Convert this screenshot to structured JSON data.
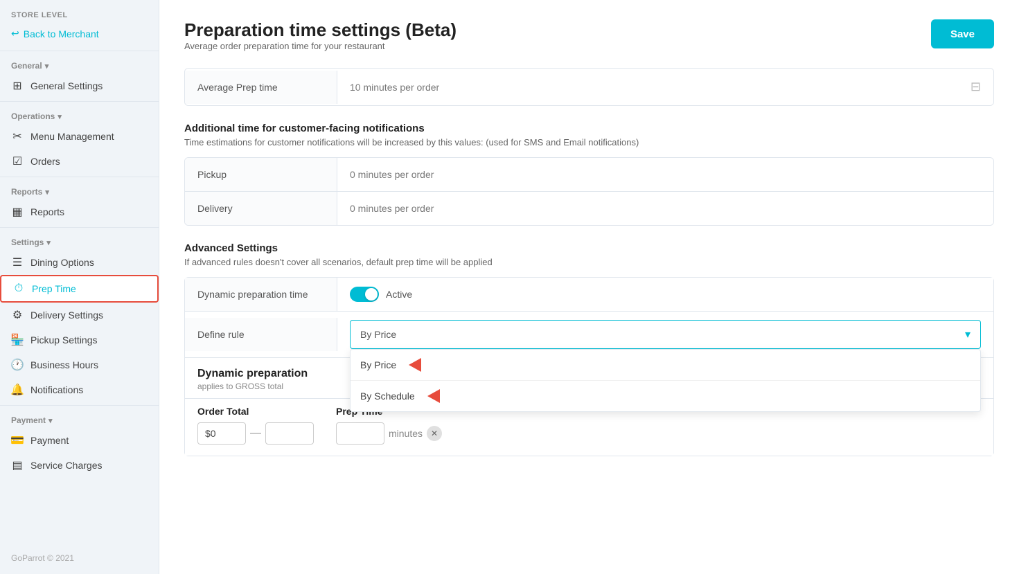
{
  "sidebar": {
    "store_level_label": "Store Level",
    "back_label": "Back to Merchant",
    "sections": [
      {
        "label": "General",
        "items": [
          {
            "id": "general-settings",
            "label": "General Settings",
            "icon": "grid"
          }
        ]
      },
      {
        "label": "Operations",
        "items": [
          {
            "id": "menu-management",
            "label": "Menu Management",
            "icon": "scissors"
          },
          {
            "id": "orders",
            "label": "Orders",
            "icon": "checkbox"
          }
        ]
      },
      {
        "label": "Reports",
        "items": [
          {
            "id": "reports",
            "label": "Reports",
            "icon": "chart"
          }
        ]
      },
      {
        "label": "Settings",
        "items": [
          {
            "id": "dining-options",
            "label": "Dining Options",
            "icon": "list"
          },
          {
            "id": "prep-time",
            "label": "Prep Time",
            "icon": "clock",
            "active": true
          },
          {
            "id": "delivery-settings",
            "label": "Delivery Settings",
            "icon": "delivery"
          },
          {
            "id": "pickup-settings",
            "label": "Pickup Settings",
            "icon": "pickup"
          },
          {
            "id": "business-hours",
            "label": "Business Hours",
            "icon": "hours"
          },
          {
            "id": "notifications",
            "label": "Notifications",
            "icon": "bell"
          }
        ]
      },
      {
        "label": "Payment",
        "items": [
          {
            "id": "payment",
            "label": "Payment",
            "icon": "payment"
          },
          {
            "id": "service-charges",
            "label": "Service Charges",
            "icon": "table"
          }
        ]
      }
    ],
    "footer": "GoParrot © 2021"
  },
  "main": {
    "title": "Preparation time settings (Beta)",
    "subtitle": "Average order preparation time for your restaurant",
    "save_button": "Save",
    "avg_prep_label": "Average Prep time",
    "avg_prep_value": "10 minutes per order",
    "additional_section": {
      "title": "Additional time for customer-facing notifications",
      "desc": "Time estimations for customer notifications will be increased by this values: (used for SMS and Email notifications)",
      "rows": [
        {
          "label": "Pickup",
          "value": "0 minutes per order"
        },
        {
          "label": "Delivery",
          "value": "0 minutes per order"
        }
      ]
    },
    "advanced_section": {
      "title": "Advanced Settings",
      "desc": "If advanced rules doesn't cover all scenarios, default prep time will be applied",
      "dynamic_prep_label": "Dynamic preparation time",
      "dynamic_prep_status": "Active",
      "define_rule_label": "Define rule",
      "define_rule_value": "By Price",
      "dropdown_options": [
        {
          "id": "by-price",
          "label": "By Price"
        },
        {
          "id": "by-schedule",
          "label": "By Schedule"
        }
      ]
    },
    "dynamic_section": {
      "title": "Dynamic preparation",
      "subtitle": "applies to GROSS total",
      "order_total_label": "Order Total",
      "prep_time_label": "Prep Time",
      "dollar_value": "$0",
      "minutes_label": "minutes"
    }
  }
}
